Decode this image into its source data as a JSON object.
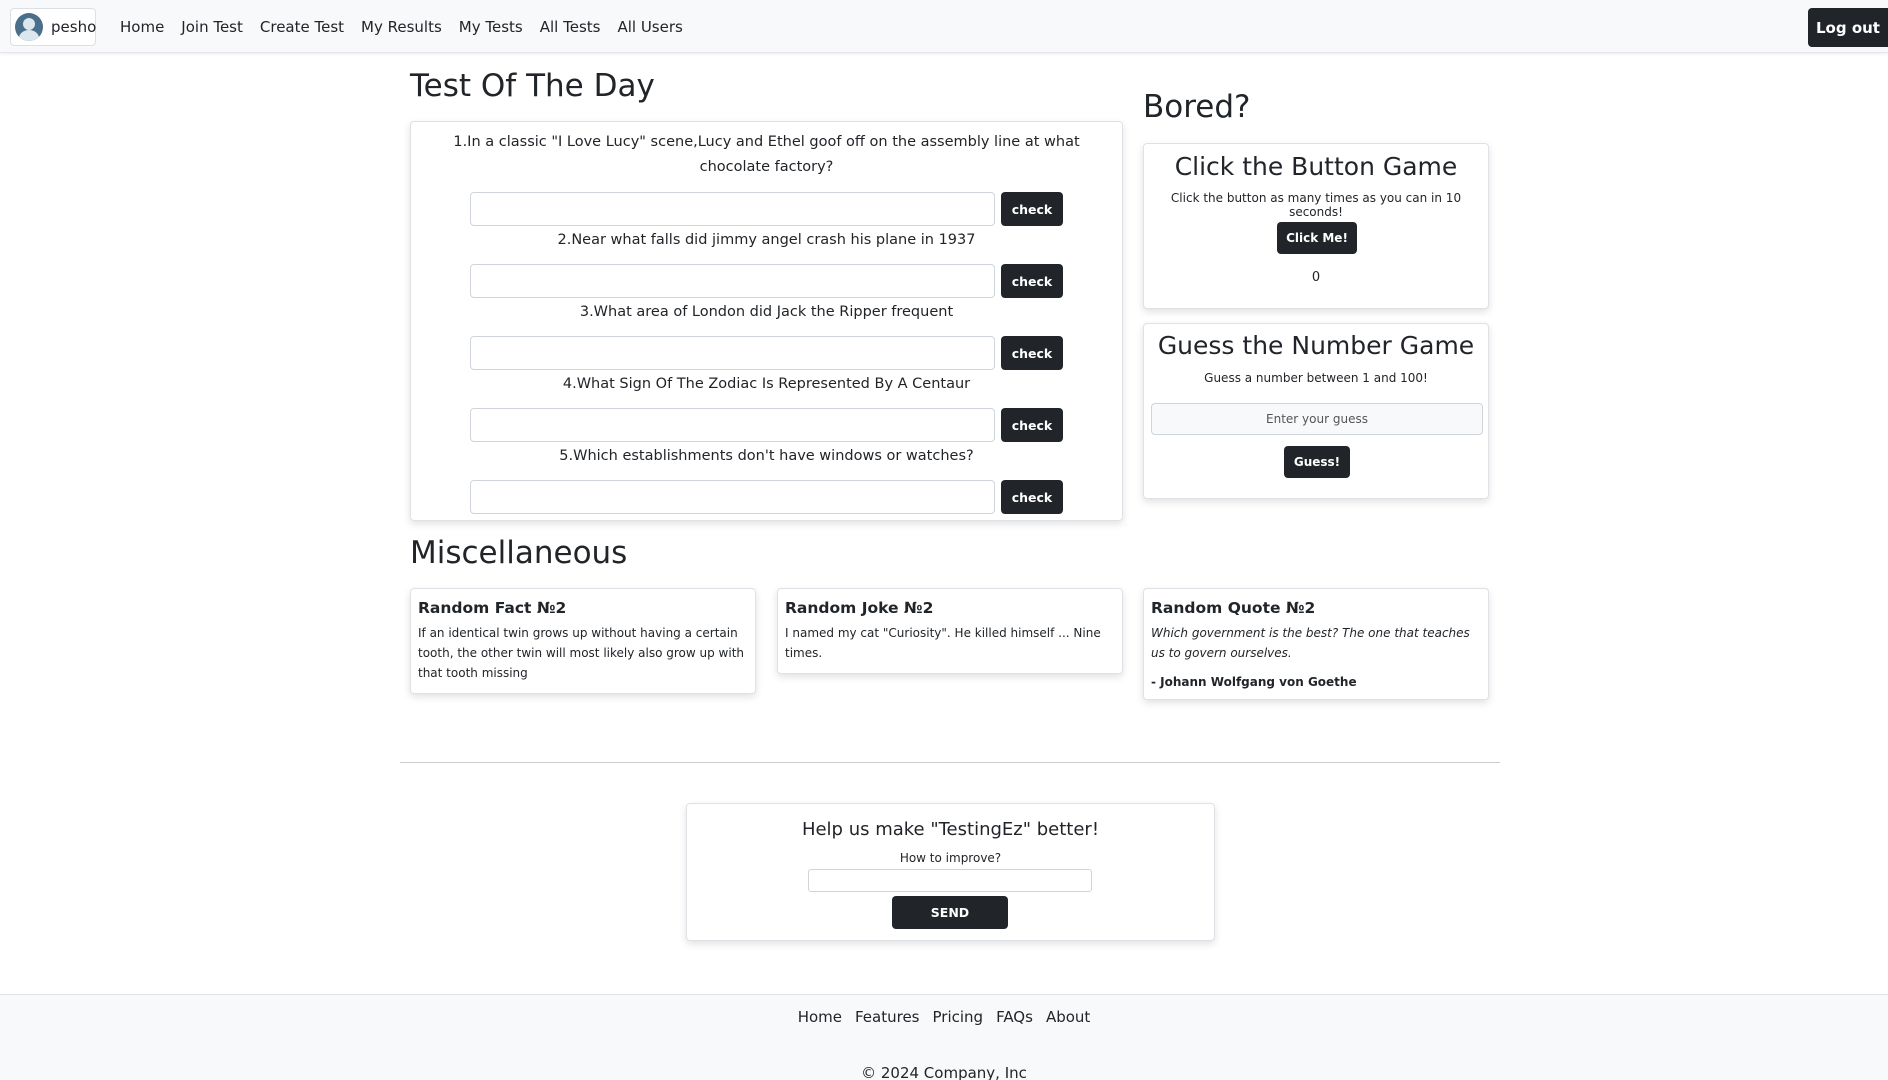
{
  "nav": {
    "username": "pesho",
    "links": [
      "Home",
      "Join Test",
      "Create Test",
      "My Results",
      "My Tests",
      "All Tests",
      "All Users"
    ],
    "logout_label": "Log out"
  },
  "test_of_day": {
    "heading": "Test Of The Day",
    "questions": [
      {
        "text": "1.In a classic \"I Love Lucy\" scene,Lucy and Ethel goof off on the assembly line at what chocolate factory?",
        "answer": ""
      },
      {
        "text": "2.Near what falls did jimmy angel crash his plane in 1937",
        "answer": ""
      },
      {
        "text": "3.What area of London did Jack the Ripper frequent",
        "answer": ""
      },
      {
        "text": "4.What Sign Of The Zodiac Is Represented By A Centaur",
        "answer": ""
      },
      {
        "text": "5.Which establishments don't have windows or watches?",
        "answer": ""
      }
    ],
    "check_label": "check"
  },
  "bored": {
    "heading": "Bored?",
    "click_game": {
      "title": "Click the Button Game",
      "description": "Click the button as many times as you can in 10 seconds!",
      "button_label": "Click Me!",
      "count": "0"
    },
    "guess_game": {
      "title": "Guess the Number Game",
      "description": "Guess a number between 1 and 100!",
      "placeholder": "Enter your guess",
      "button_label": "Guess!"
    }
  },
  "misc": {
    "heading": "Miscellaneous",
    "fact": {
      "title": "Random Fact №2",
      "text": "If an identical twin grows up without having a certain tooth, the other twin will most likely also grow up with that tooth missing"
    },
    "joke": {
      "title": "Random Joke №2",
      "text": "I named my cat \"Curiosity\". He killed himself ... Nine times."
    },
    "quote": {
      "title": "Random Quote №2",
      "text": "Which government is the best? The one that teaches us to govern ourselves.",
      "author": "- Johann Wolfgang von Goethe"
    }
  },
  "feedback": {
    "title": "Help us make \"TestingEz\" better!",
    "label": "How to improve?",
    "value": "",
    "send_label": "SEND"
  },
  "footer": {
    "links": [
      "Home",
      "Features",
      "Pricing",
      "FAQs",
      "About"
    ],
    "copyright": "© 2024 Company, Inc"
  }
}
